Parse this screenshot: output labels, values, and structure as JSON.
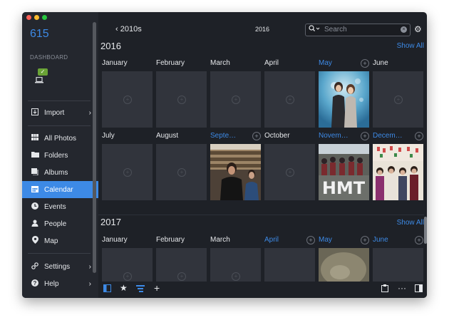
{
  "window": {
    "traffic_colors": [
      "#fc5f57",
      "#fdbc2e",
      "#28c840"
    ]
  },
  "sidebar": {
    "brand": "615",
    "dashboard_label": "DASHBOARD",
    "device_badge": "✓",
    "items": [
      {
        "label": "Import",
        "icon": "import-icon",
        "chevron": "›"
      },
      {
        "label": "All Photos",
        "icon": "grid-icon"
      },
      {
        "label": "Folders",
        "icon": "folder-icon"
      },
      {
        "label": "Albums",
        "icon": "album-icon"
      },
      {
        "label": "Calendar",
        "icon": "calendar-icon",
        "active": true
      },
      {
        "label": "Events",
        "icon": "clock-icon"
      },
      {
        "label": "People",
        "icon": "person-icon"
      },
      {
        "label": "Map",
        "icon": "pin-icon"
      },
      {
        "label": "Settings",
        "icon": "settings-icon",
        "chevron": "›"
      },
      {
        "label": "Help",
        "icon": "help-icon",
        "chevron": "›"
      }
    ]
  },
  "toolbar": {
    "back_label": "2010s",
    "title": "2016",
    "search_placeholder": "Search"
  },
  "years": [
    {
      "year": "2016",
      "show_all": "Show All",
      "rows": [
        [
          {
            "name": "January",
            "blue": false,
            "photo": false
          },
          {
            "name": "February",
            "blue": false,
            "photo": false
          },
          {
            "name": "March",
            "blue": false,
            "photo": false
          },
          {
            "name": "April",
            "blue": false,
            "photo": false
          },
          {
            "name": "May",
            "blue": true,
            "photo": true
          },
          {
            "name": "June",
            "blue": false,
            "photo": false
          }
        ],
        [
          {
            "name": "July",
            "blue": false,
            "photo": false
          },
          {
            "name": "August",
            "blue": false,
            "photo": false
          },
          {
            "name": "Septe…",
            "blue": true,
            "photo": true
          },
          {
            "name": "October",
            "blue": false,
            "photo": false
          },
          {
            "name": "Novem…",
            "blue": true,
            "photo": true
          },
          {
            "name": "Decem…",
            "blue": true,
            "photo": true
          }
        ]
      ]
    },
    {
      "year": "2017",
      "show_all": "Show All",
      "rows": [
        [
          {
            "name": "January",
            "blue": false,
            "photo": false
          },
          {
            "name": "February",
            "blue": false,
            "photo": false
          },
          {
            "name": "March",
            "blue": false,
            "photo": false
          },
          {
            "name": "April",
            "blue": true,
            "photo": false
          },
          {
            "name": "May",
            "blue": true,
            "photo": true
          },
          {
            "name": "June",
            "blue": true,
            "photo": false
          }
        ]
      ]
    }
  ],
  "photo_texts": {
    "hmt": "HMT"
  },
  "bottom_bar": {
    "left": [
      "sidebar-toggle-icon",
      "star-icon",
      "sort-icon",
      "add-icon"
    ],
    "right": [
      "clipboard-icon",
      "more-icon",
      "panel-icon"
    ],
    "more": "···"
  }
}
